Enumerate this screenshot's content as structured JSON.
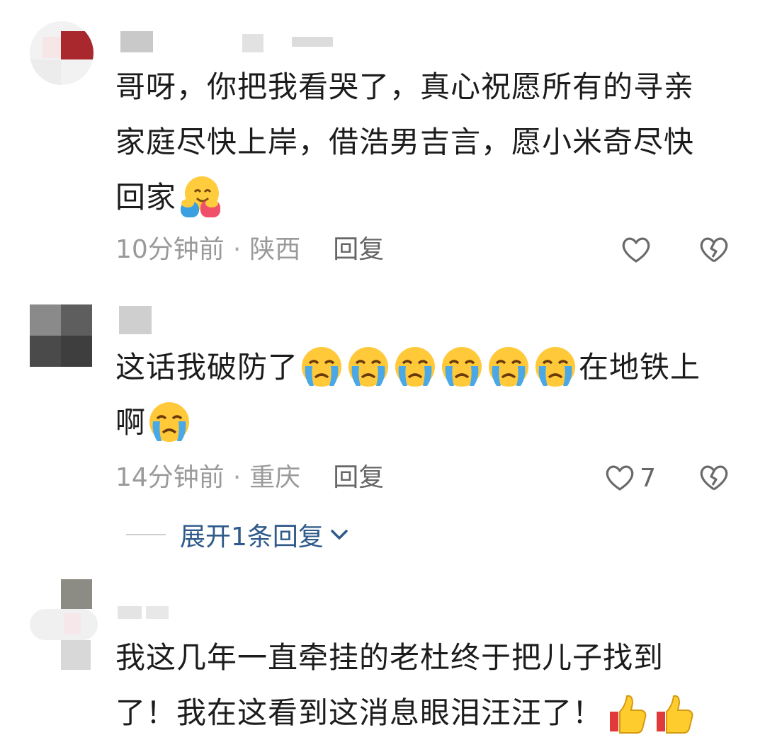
{
  "comments": [
    {
      "text_lines": [
        "哥呀，你把我看哭了，真心祝愿所有的寻亲",
        "家庭尽快上岸，借浩男吉言，愿小米奇尽快",
        "回家"
      ],
      "trailing_emoji": "hugging-face",
      "time": "10分钟前",
      "location": "陕西",
      "reply_label": "回复",
      "like_count": ""
    },
    {
      "text_lines": [
        "这话我破防了",
        "在地铁上",
        "啊"
      ],
      "inline_emoji": "loudly-crying-face",
      "inline_emoji_count": 6,
      "time": "14分钟前",
      "location": "重庆",
      "reply_label": "回复",
      "like_count": "7"
    },
    {
      "text_lines": [
        "我这几年一直牵挂的老杜终于把儿子找到",
        "了！我在这看到这消息眼泪汪汪了！"
      ],
      "trailing_emoji": "thumbs-up",
      "trailing_emoji_count": 2
    }
  ],
  "expand_replies_label": "展开1条回复",
  "separator": "·",
  "colors": {
    "meta_text": "#9a9a9a",
    "link_blue": "#2f5a8a",
    "icon_gray": "#6a6a6a"
  }
}
